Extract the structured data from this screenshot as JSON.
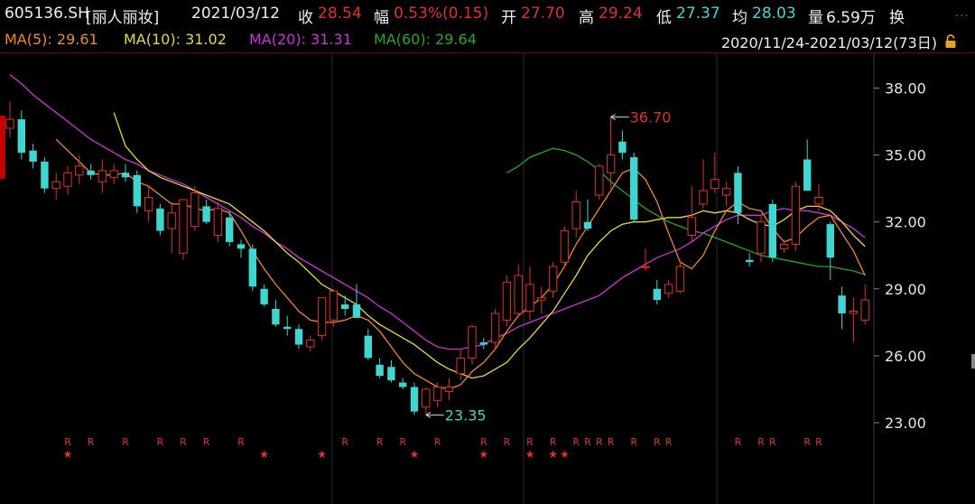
{
  "header": {
    "code": "605136.SH",
    "name": "[丽人丽妆]",
    "date": "2021/03/12",
    "close_label": "收",
    "close": "28.54",
    "change_label": "幅",
    "change": "0.53%(0.15)",
    "open_label": "开",
    "open": "27.70",
    "high_label": "高",
    "high": "29.24",
    "low_label": "低",
    "low": "27.37",
    "avg_label": "均",
    "avg": "28.03",
    "volume_label": "量",
    "volume": "6.59万",
    "turnover_label": "换",
    "more": "..."
  },
  "ma_bar": {
    "ma5": "MA(5): 29.61",
    "ma10": "MA(10): 31.02",
    "ma20": "MA(20): 31.31",
    "ma60": "MA(60): 29.64",
    "range": "2020/11/24-2021/03/12(73日)"
  },
  "colors": {
    "up": "#e0302a",
    "down": "#3fd6d0",
    "ma5": "#f08a20",
    "ma10": "#e8d83a",
    "ma20": "#d030d8",
    "ma60": "#22a822",
    "axis_text": "#e6e6e6",
    "grid": "#2a2a2a"
  },
  "chart_data": {
    "type": "candlestick",
    "ylim": [
      22.5,
      39.5
    ],
    "y_ticks": [
      "38.00",
      "35.00",
      "32.00",
      "29.00",
      "26.00",
      "23.00"
    ],
    "y_tick_values": [
      38,
      35,
      32,
      29,
      26,
      23
    ],
    "annotations": [
      {
        "label": "36.70",
        "value": 36.7,
        "index": 52,
        "color": "#e0302a"
      },
      {
        "label": "23.35",
        "value": 23.35,
        "index": 36,
        "color": "#3fd6d0"
      }
    ],
    "candles": [
      [
        36.2,
        37.4,
        35.8,
        36.6
      ],
      [
        36.6,
        37.0,
        34.8,
        35.1
      ],
      [
        35.2,
        35.5,
        34.4,
        34.7
      ],
      [
        34.7,
        34.9,
        33.3,
        33.5
      ],
      [
        33.5,
        34.2,
        33.0,
        33.8
      ],
      [
        33.6,
        34.5,
        33.2,
        34.2
      ],
      [
        34.1,
        35.0,
        33.7,
        34.5
      ],
      [
        34.3,
        34.6,
        33.9,
        34.1
      ],
      [
        33.8,
        34.8,
        33.3,
        34.3
      ],
      [
        34.0,
        34.6,
        33.7,
        34.3
      ],
      [
        34.2,
        34.6,
        33.8,
        34.0
      ],
      [
        34.1,
        34.3,
        32.4,
        32.7
      ],
      [
        32.5,
        33.6,
        32.0,
        33.1
      ],
      [
        32.6,
        32.8,
        31.4,
        31.6
      ],
      [
        31.7,
        32.9,
        30.6,
        32.4
      ],
      [
        30.6,
        33.0,
        30.3,
        33.0
      ],
      [
        31.8,
        33.6,
        31.6,
        33.3
      ],
      [
        32.7,
        33.0,
        31.9,
        32.0
      ],
      [
        31.4,
        32.9,
        31.1,
        32.6
      ],
      [
        32.2,
        32.5,
        30.9,
        31.1
      ],
      [
        31.0,
        31.2,
        30.4,
        30.8
      ],
      [
        30.8,
        31.0,
        28.9,
        29.1
      ],
      [
        29.0,
        29.2,
        28.2,
        28.3
      ],
      [
        28.1,
        28.5,
        27.3,
        27.4
      ],
      [
        27.3,
        27.8,
        26.9,
        27.2
      ],
      [
        27.2,
        27.4,
        26.3,
        26.5
      ],
      [
        26.4,
        26.9,
        26.2,
        26.7
      ],
      [
        26.9,
        28.6,
        26.7,
        28.6
      ],
      [
        27.6,
        29.0,
        27.3,
        28.9
      ],
      [
        28.3,
        28.7,
        27.8,
        28.1
      ],
      [
        28.3,
        29.2,
        27.8,
        27.7
      ],
      [
        26.9,
        27.2,
        25.8,
        25.9
      ],
      [
        25.6,
        25.9,
        25.0,
        25.1
      ],
      [
        25.5,
        25.8,
        24.8,
        24.9
      ],
      [
        24.8,
        25.0,
        24.5,
        24.6
      ],
      [
        24.6,
        24.8,
        23.35,
        23.5
      ],
      [
        23.7,
        24.6,
        23.4,
        24.5
      ],
      [
        24.0,
        24.8,
        23.7,
        24.6
      ],
      [
        24.4,
        25.0,
        24.0,
        24.6
      ],
      [
        25.2,
        26.3,
        24.9,
        25.9
      ],
      [
        25.9,
        27.4,
        25.6,
        27.3
      ],
      [
        26.6,
        26.8,
        26.3,
        26.5
      ],
      [
        26.6,
        28.1,
        26.3,
        27.9
      ],
      [
        27.6,
        29.6,
        27.3,
        29.3
      ],
      [
        27.9,
        30.1,
        27.7,
        29.6
      ],
      [
        28.0,
        30.0,
        27.6,
        29.2
      ],
      [
        28.5,
        29.1,
        27.9,
        28.6
      ],
      [
        28.9,
        30.2,
        28.6,
        30.0
      ],
      [
        30.2,
        31.8,
        30.0,
        31.6
      ],
      [
        31.7,
        33.4,
        31.3,
        32.9
      ],
      [
        32.0,
        33.0,
        31.6,
        31.7
      ],
      [
        33.2,
        34.6,
        33.0,
        34.5
      ],
      [
        34.2,
        36.7,
        33.5,
        35.0
      ],
      [
        35.6,
        36.1,
        34.8,
        35.1
      ],
      [
        34.9,
        35.1,
        32.0,
        32.1
      ],
      [
        30.0,
        30.8,
        29.8,
        30.0
      ],
      [
        29.0,
        29.4,
        28.3,
        28.5
      ],
      [
        28.8,
        29.4,
        28.6,
        29.2
      ],
      [
        28.9,
        30.3,
        28.8,
        30.0
      ],
      [
        31.4,
        33.6,
        31.1,
        32.2
      ],
      [
        32.8,
        34.8,
        32.6,
        33.4
      ],
      [
        33.5,
        35.1,
        33.3,
        33.9
      ],
      [
        33.2,
        33.8,
        32.7,
        33.5
      ],
      [
        34.2,
        34.5,
        31.9,
        32.4
      ],
      [
        30.3,
        30.6,
        30.0,
        30.2
      ],
      [
        30.6,
        32.3,
        30.2,
        32.0
      ],
      [
        32.8,
        33.0,
        30.2,
        30.4
      ],
      [
        30.8,
        31.2,
        30.6,
        31.0
      ],
      [
        31.0,
        33.8,
        30.7,
        33.6
      ],
      [
        34.8,
        35.7,
        33.4,
        33.4
      ],
      [
        32.8,
        33.7,
        32.5,
        33.1
      ],
      [
        31.9,
        32.0,
        29.4,
        30.4
      ],
      [
        28.7,
        29.1,
        27.2,
        27.9
      ],
      [
        27.9,
        28.6,
        26.6,
        28.0
      ],
      [
        27.6,
        29.2,
        27.4,
        28.5
      ]
    ],
    "ma5": [
      null,
      null,
      null,
      null,
      35.7,
      35.2,
      34.7,
      34.2,
      34.1,
      34.1,
      34.2,
      33.8,
      33.6,
      33.2,
      32.8,
      32.8,
      32.6,
      32.5,
      32.6,
      32.4,
      31.6,
      30.7,
      29.9,
      29.2,
      28.6,
      28.0,
      27.6,
      27.5,
      27.5,
      27.6,
      27.8,
      27.6,
      27.1,
      26.4,
      25.7,
      25.2,
      24.9,
      24.6,
      24.5,
      24.7,
      25.3,
      25.7,
      26.3,
      27.1,
      27.8,
      28.2,
      28.6,
      29.2,
      30.0,
      31.0,
      31.8,
      32.6,
      33.4,
      34.2,
      34.4,
      33.9,
      32.9,
      31.5,
      30.2,
      29.9,
      30.5,
      31.6,
      32.5,
      32.9,
      32.6,
      32.5,
      31.7,
      31.1,
      31.3,
      31.8,
      32.2,
      32.3,
      31.5,
      30.7,
      29.6
    ],
    "ma10": [
      null,
      null,
      null,
      null,
      null,
      null,
      null,
      null,
      null,
      36.9,
      35.4,
      34.8,
      34.3,
      34.0,
      33.8,
      33.6,
      33.4,
      33.2,
      33.0,
      32.8,
      32.4,
      32.0,
      31.6,
      31.1,
      30.6,
      30.2,
      29.7,
      29.2,
      28.9,
      28.6,
      28.3,
      27.8,
      27.4,
      27.1,
      26.8,
      26.5,
      26.1,
      25.7,
      25.4,
      25.2,
      25.0,
      25.1,
      25.4,
      25.7,
      26.3,
      26.8,
      27.4,
      28.0,
      28.8,
      29.6,
      30.5,
      31.1,
      31.6,
      31.9,
      32.0,
      32.0,
      32.1,
      32.2,
      32.2,
      32.3,
      32.5,
      32.4,
      32.5,
      32.4,
      32.1,
      31.9,
      31.8,
      32.1,
      32.5,
      32.7,
      32.7,
      32.5,
      32.0,
      31.4,
      30.9
    ],
    "ma20": [
      38.6,
      38.2,
      37.7,
      37.3,
      36.9,
      36.5,
      36.1,
      35.7,
      35.4,
      35.1,
      34.8,
      34.6,
      34.3,
      34.1,
      33.9,
      33.7,
      33.4,
      33.1,
      32.8,
      32.5,
      32.2,
      31.8,
      31.5,
      31.1,
      30.8,
      30.4,
      30.1,
      29.8,
      29.5,
      29.2,
      28.9,
      28.6,
      28.2,
      27.9,
      27.5,
      27.1,
      26.7,
      26.4,
      26.3,
      26.3,
      26.4,
      26.5,
      26.8,
      27.0,
      27.3,
      27.5,
      27.7,
      27.9,
      28.1,
      28.3,
      28.5,
      28.7,
      29.1,
      29.5,
      29.8,
      30.1,
      30.4,
      30.6,
      30.8,
      31.1,
      31.5,
      31.8,
      32.1,
      32.3,
      32.3,
      32.3,
      32.5,
      32.6,
      32.5,
      32.5,
      32.4,
      32.3,
      32.0,
      31.7,
      31.3
    ],
    "ma60": [
      null,
      null,
      null,
      null,
      null,
      null,
      null,
      null,
      null,
      null,
      null,
      null,
      null,
      null,
      null,
      null,
      null,
      null,
      null,
      null,
      null,
      null,
      null,
      null,
      null,
      null,
      null,
      null,
      null,
      null,
      null,
      null,
      null,
      null,
      null,
      null,
      null,
      null,
      null,
      null,
      null,
      null,
      null,
      34.2,
      34.5,
      34.9,
      35.1,
      35.3,
      35.2,
      35.0,
      34.7,
      34.3,
      33.8,
      33.4,
      33.0,
      32.6,
      32.3,
      32.0,
      31.8,
      31.6,
      31.5,
      31.3,
      31.1,
      30.9,
      30.7,
      30.5,
      30.4,
      30.3,
      30.2,
      30.1,
      30.0,
      30.0,
      29.9,
      29.8,
      29.64
    ],
    "r_marks": [
      5,
      7,
      10,
      13,
      15,
      17,
      20,
      29,
      32,
      34,
      37,
      41,
      43,
      45,
      47,
      49,
      50,
      51,
      52,
      54,
      56,
      57,
      63,
      65,
      66,
      69,
      70
    ],
    "star_marks": [
      5,
      22,
      27,
      35,
      41,
      45,
      47,
      48
    ]
  }
}
